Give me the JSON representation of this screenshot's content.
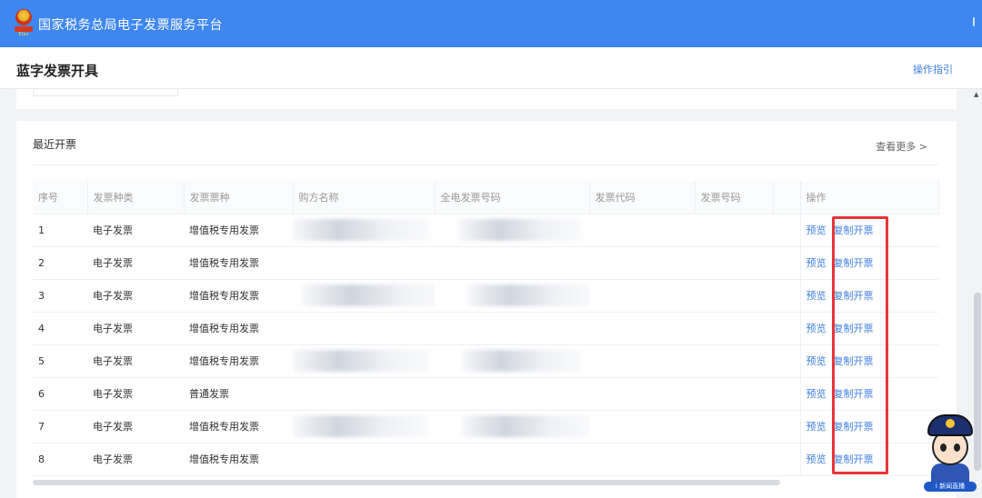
{
  "header": {
    "emblem_text": "Etax",
    "platform_title": "国家税务总局电子发票服务平台"
  },
  "titlebar": {
    "page_title": "蓝字发票开具",
    "guide_link": "操作指引"
  },
  "recent": {
    "title": "最近开票",
    "more_link": "查看更多 >",
    "columns": [
      "序号",
      "发票种类",
      "发票票种",
      "购方名称",
      "全电发票号码",
      "发票代码",
      "发票号码",
      "",
      "操作"
    ],
    "rows": [
      {
        "no": "1",
        "kind": "电子发票",
        "type": "增值税专用发票",
        "preview": "预览",
        "copy": "复制开票"
      },
      {
        "no": "2",
        "kind": "电子发票",
        "type": "增值税专用发票",
        "preview": "预览",
        "copy": "复制开票"
      },
      {
        "no": "3",
        "kind": "电子发票",
        "type": "增值税专用发票",
        "preview": "预览",
        "copy": "复制开票"
      },
      {
        "no": "4",
        "kind": "电子发票",
        "type": "增值税专用发票",
        "preview": "预览",
        "copy": "复制开票"
      },
      {
        "no": "5",
        "kind": "电子发票",
        "type": "增值税专用发票",
        "preview": "预览",
        "copy": "复制开票"
      },
      {
        "no": "6",
        "kind": "电子发票",
        "type": "普通发票",
        "preview": "预览",
        "copy": "复制开票"
      },
      {
        "no": "7",
        "kind": "电子发票",
        "type": "增值税专用发票",
        "preview": "预览",
        "copy": "复制开票"
      },
      {
        "no": "8",
        "kind": "电子发票",
        "type": "增值税专用发票",
        "preview": "预览",
        "copy": "复制开票"
      }
    ]
  },
  "mascot": {
    "label": "i 新闻直播"
  },
  "colors": {
    "header_blue": "#3e87f0",
    "link_blue": "#3e7fe0",
    "highlight_red": "#e8343a"
  }
}
